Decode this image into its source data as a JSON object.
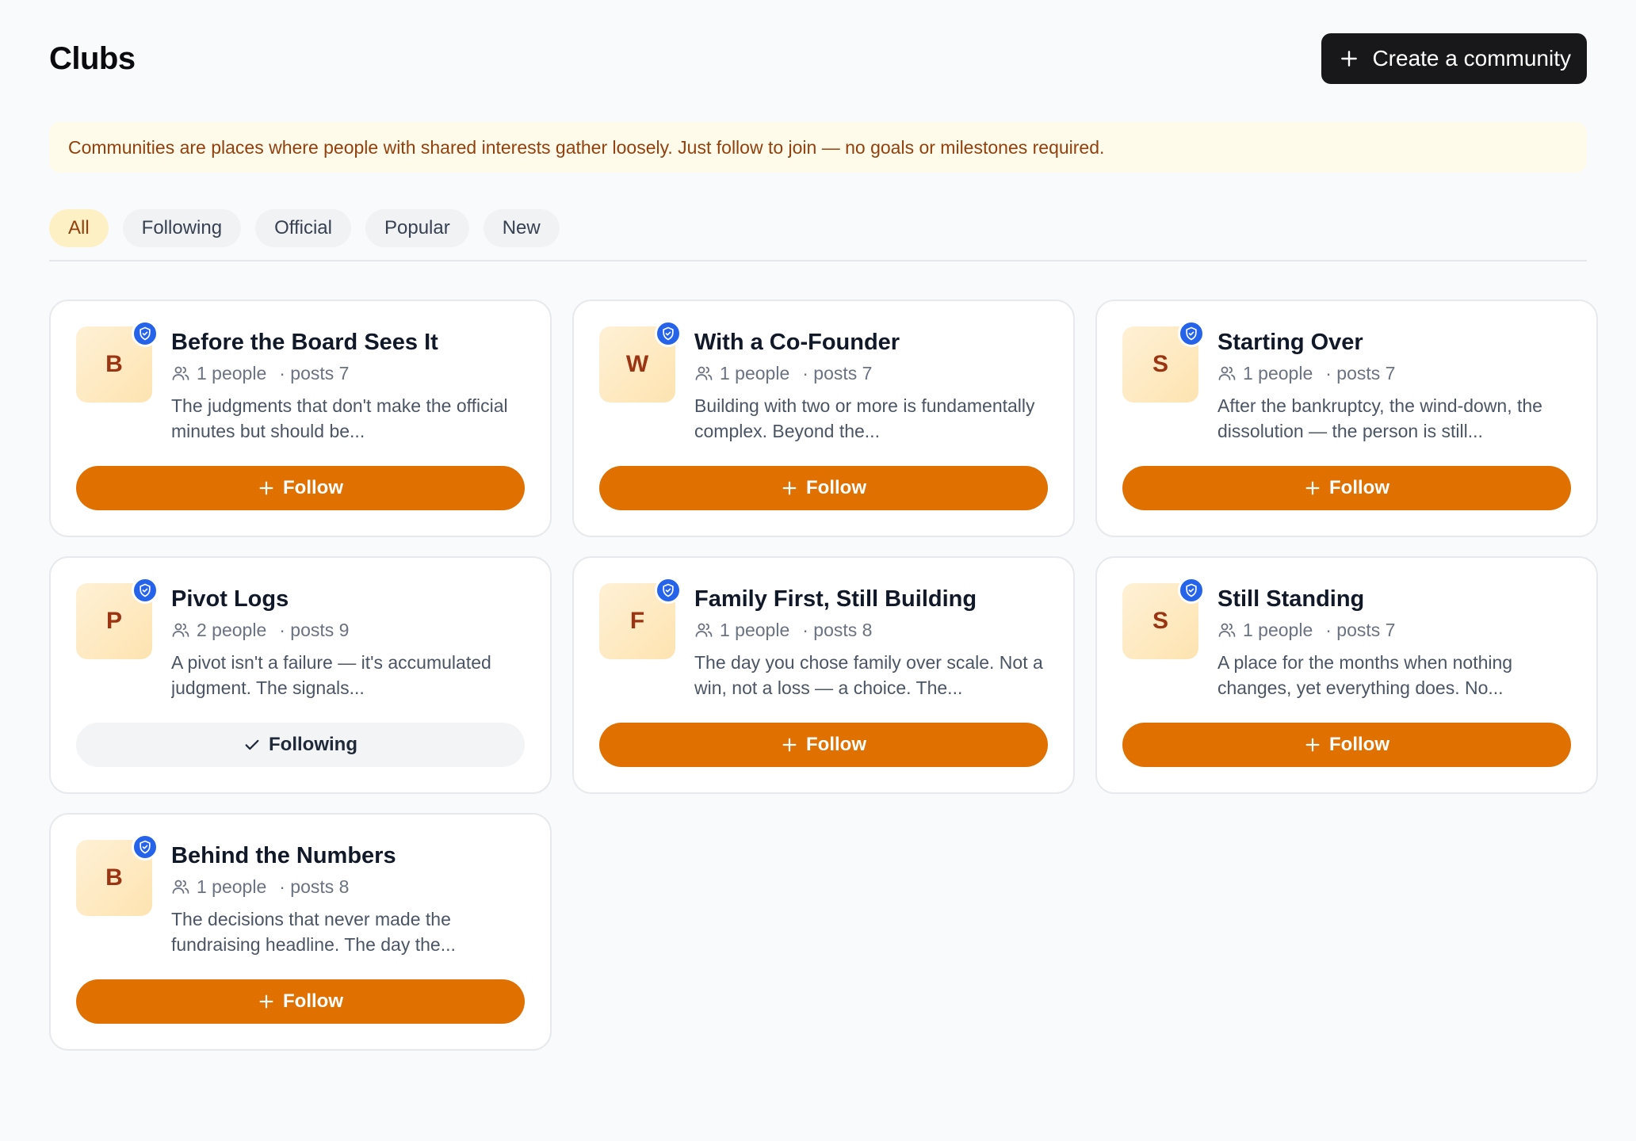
{
  "header": {
    "title": "Clubs",
    "create_label": "Create a community"
  },
  "notice": {
    "text": "Communities are places where people with shared interests gather loosely. Just follow to join — no goals or milestones required."
  },
  "filters": [
    {
      "label": "All",
      "active": true
    },
    {
      "label": "Following",
      "active": false
    },
    {
      "label": "Official",
      "active": false
    },
    {
      "label": "Popular",
      "active": false
    },
    {
      "label": "New",
      "active": false
    }
  ],
  "clubs": [
    {
      "initial": "B",
      "name": "Before the Board Sees It",
      "people": "1 people",
      "posts": "· posts 7",
      "description": "The judgments that don't make the official minutes but should be...",
      "verified": true,
      "following": false,
      "button_label": "Follow"
    },
    {
      "initial": "W",
      "name": "With a Co-Founder",
      "people": "1 people",
      "posts": "· posts 7",
      "description": "Building with two or more is fundamentally complex. Beyond the...",
      "verified": true,
      "following": false,
      "button_label": "Follow"
    },
    {
      "initial": "S",
      "name": "Starting Over",
      "people": "1 people",
      "posts": "· posts 7",
      "description": "After the bankruptcy, the wind-down, the dissolution — the person is still...",
      "verified": true,
      "following": false,
      "button_label": "Follow"
    },
    {
      "initial": "P",
      "name": "Pivot Logs",
      "people": "2 people",
      "posts": "· posts 9",
      "description": "A pivot isn't a failure — it's accumulated judgment. The signals...",
      "verified": true,
      "following": true,
      "button_label": "Following"
    },
    {
      "initial": "F",
      "name": "Family First, Still Building",
      "people": "1 people",
      "posts": "· posts 8",
      "description": "The day you chose family over scale. Not a win, not a loss — a choice. The...",
      "verified": true,
      "following": false,
      "button_label": "Follow"
    },
    {
      "initial": "S",
      "name": "Still Standing",
      "people": "1 people",
      "posts": "· posts 7",
      "description": "A place for the months when nothing changes, yet everything does. No...",
      "verified": true,
      "following": false,
      "button_label": "Follow"
    },
    {
      "initial": "B",
      "name": "Behind the Numbers",
      "people": "1 people",
      "posts": "· posts 8",
      "description": "The decisions that never made the fundraising headline. The day the...",
      "verified": true,
      "following": false,
      "button_label": "Follow"
    }
  ],
  "colors": {
    "accent": "#e07000",
    "verified": "#2563eb",
    "notice_bg": "#fffbeb",
    "notice_text": "#92400e"
  },
  "icons": {
    "create": "plus-icon",
    "verified": "shield-check-icon",
    "people": "people-icon",
    "follow": "plus-icon",
    "following": "check-icon"
  }
}
